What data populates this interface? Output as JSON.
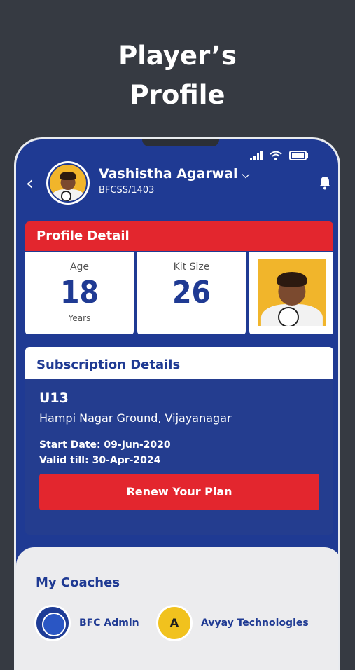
{
  "headline": {
    "line1": "Player’s",
    "line2": "Profile"
  },
  "header": {
    "back_icon": "chevron-left-icon",
    "player_name": "Vashistha Agarwal",
    "player_id": "BFCSS/1403",
    "bell_icon": "bell-icon"
  },
  "profile_detail": {
    "title": "Profile Detail",
    "age_label": "Age",
    "age_value": "18",
    "age_unit": "Years",
    "kit_label": "Kit Size",
    "kit_value": "26"
  },
  "subscription": {
    "title": "Subscription Details",
    "group": "U13",
    "location": "Hampi Nagar Ground, Vijayanagar",
    "start_date": "Start Date: 09-Jun-2020",
    "valid_till": "Valid till: 30-Apr-2024",
    "renew_label": "Renew Your Plan"
  },
  "coaches": {
    "title": "My Coaches",
    "items": [
      {
        "name": "BFC Admin"
      },
      {
        "initial": "A",
        "name": "Avyay Technologies"
      }
    ]
  },
  "colors": {
    "brand_blue": "#1f3a93",
    "accent_red": "#e3262e",
    "dark_bg": "#363a42",
    "avatar_yellow": "#f1b52b"
  }
}
